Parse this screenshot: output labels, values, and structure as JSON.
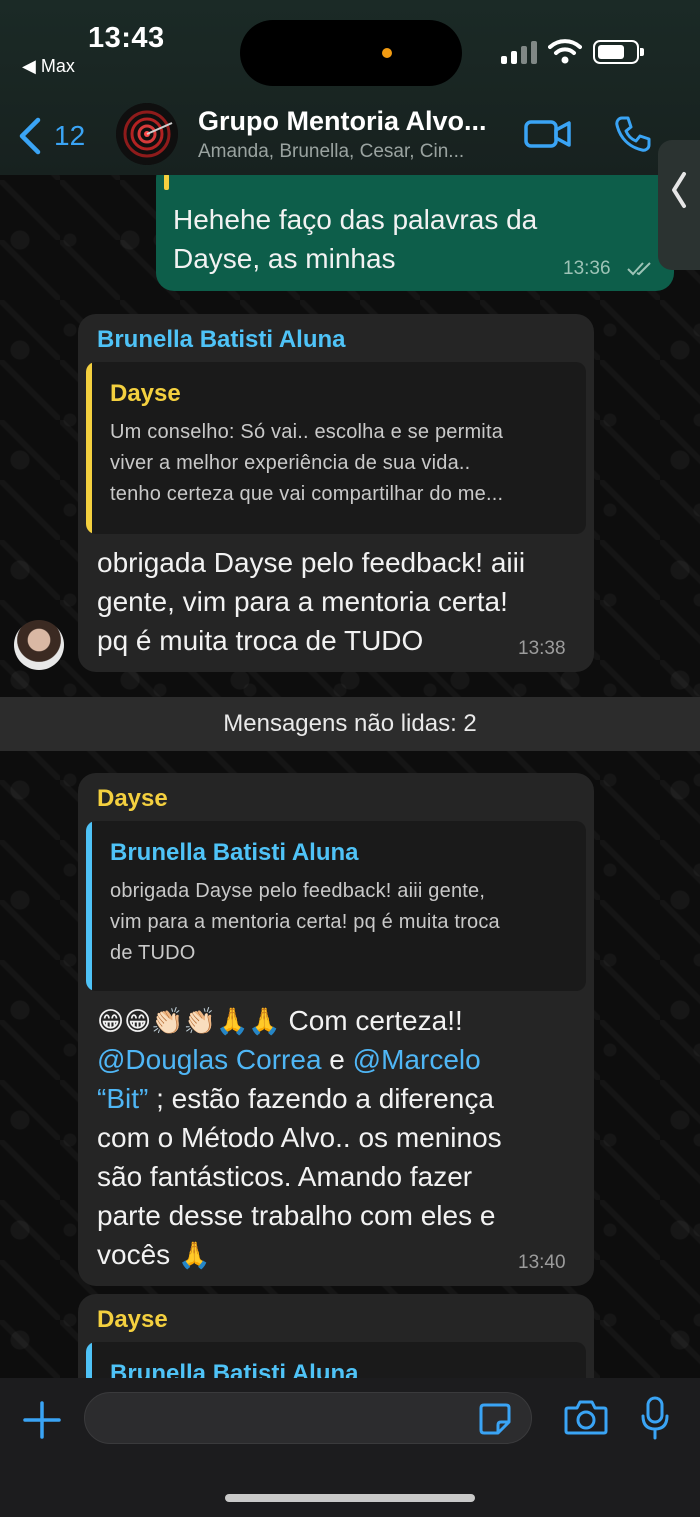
{
  "status_bar": {
    "time": "13:43",
    "back_app": "◀ Max"
  },
  "header": {
    "back_count": "12",
    "group_name": "Grupo Mentoria Alvo...",
    "members": "Amanda, Brunella, Cesar, Cin...",
    "accent_color": "#3aa4f5"
  },
  "messages": [
    {
      "id": "m1",
      "direction": "outgoing",
      "text_line1": "Hehehe faço das palavras da",
      "text_line2": "Dayse, as minhas",
      "time": "13:36"
    },
    {
      "id": "m2",
      "direction": "incoming",
      "sender": "Brunella Batisti Aluna",
      "sender_color": "#4fc3f7",
      "quote": {
        "author": "Dayse",
        "author_color": "#f4d03f",
        "line1": "Um conselho: Só vai.. escolha e se permita",
        "line2": "viver a melhor experiência de sua vida..",
        "line3": "tenho certeza que vai compartilhar do me..."
      },
      "line1": "obrigada Dayse pelo feedback! aiii",
      "line2": "gente, vim para a mentoria certa!",
      "line3": "pq é muita troca de TUDO",
      "time": "13:38"
    },
    {
      "id": "m3",
      "direction": "incoming",
      "sender": "Dayse",
      "sender_color": "#f4d03f",
      "quote": {
        "author": "Brunella Batisti Aluna",
        "author_color": "#4fc3f7",
        "line1": "obrigada Dayse pelo feedback! aiii gente,",
        "line2": "vim para a mentoria certa! pq é muita troca",
        "line3": "de TUDO"
      },
      "emojis": "😁😁👏🏻👏🏻🙏🙏",
      "line1_text": " Com certeza!!",
      "mention1": "@Douglas Correa",
      "connector": " e ",
      "mention2_a": "@Marcelo",
      "mention2_b": "“Bit”",
      "line3_text": " ; estão fazendo a diferença",
      "line4": "com o Método Alvo.. os meninos",
      "line5": "são fantásticos. Amando fazer",
      "line6": "parte desse trabalho com eles e",
      "line7": "vocês ",
      "line7_emoji": "🙏",
      "time": "13:40"
    },
    {
      "id": "m4",
      "direction": "incoming",
      "sender": "Dayse",
      "quote_author": "Brunella Batisti Aluna"
    }
  ],
  "unread_banner": "Mensagens não lidas: 2",
  "composer": {
    "placeholder": ""
  },
  "colors": {
    "outgoing_bubble": "#0d5e4a",
    "incoming_bubble": "#252525",
    "mention": "#4fb6f5"
  }
}
